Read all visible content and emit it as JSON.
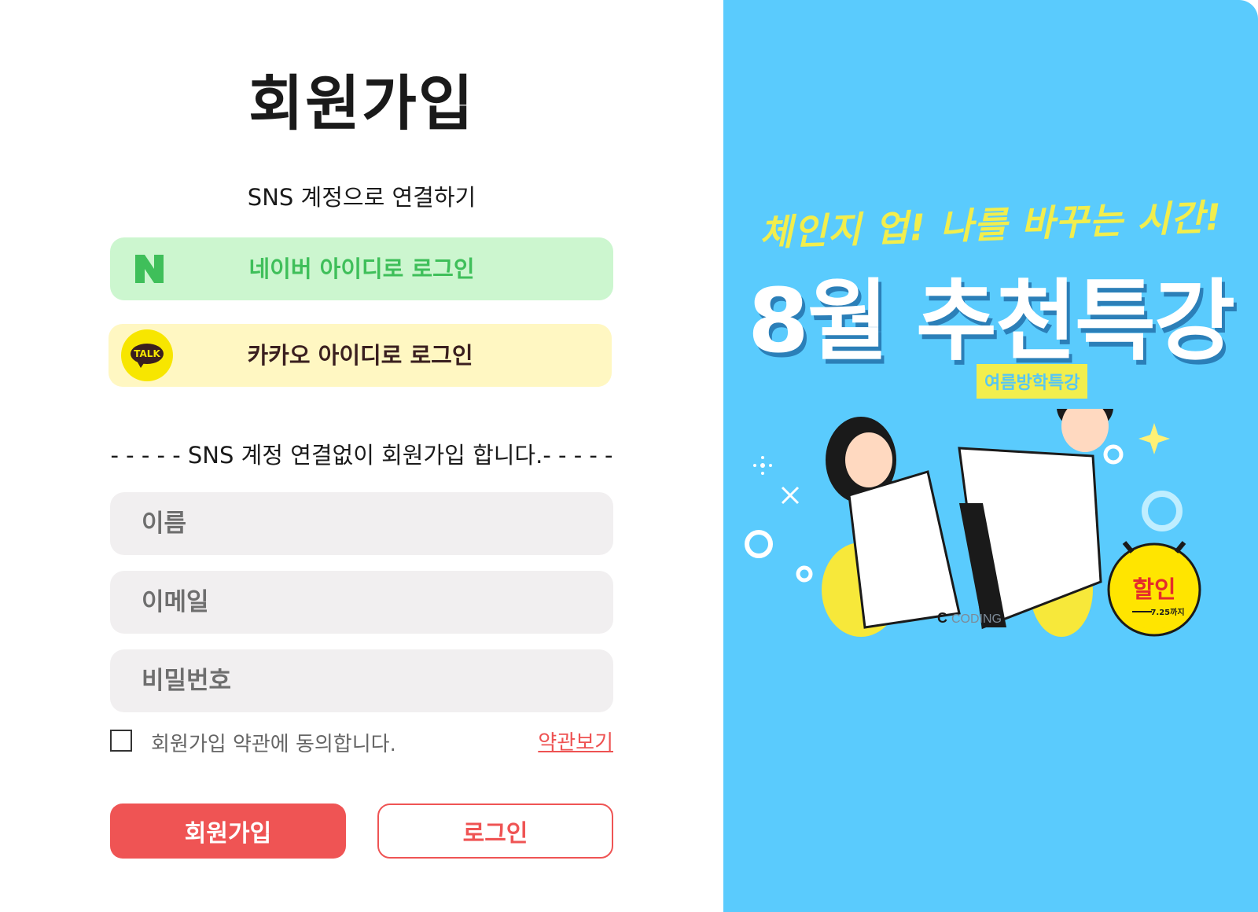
{
  "signup": {
    "title": "회원가입",
    "sns_caption": "SNS 계정으로 연결하기",
    "naver_label": "네이버 아이디로 로그인",
    "kakao_label": "카카오 아이디로 로그인",
    "kakao_logo_text": "TALK",
    "divider_text": "- - - - - SNS 계정 연결없이 회원가입 합니다.- - - - -",
    "name_placeholder": "이름",
    "email_placeholder": "이메일",
    "password_placeholder": "비밀번호",
    "agree_text": "회원가입 약관에 동의합니다.",
    "terms_link": "약관보기",
    "join_button": "회원가입",
    "login_button": "로그인"
  },
  "banner": {
    "slogan": "체인지 업! 나를 바꾸는 시간!",
    "headline": "8월 추천특강",
    "sub_badge": "여름방학특강",
    "sale_label": "할인",
    "sale_date": "7.25까지",
    "brand_text": "CODING",
    "bg_color": "#5acbfd"
  }
}
